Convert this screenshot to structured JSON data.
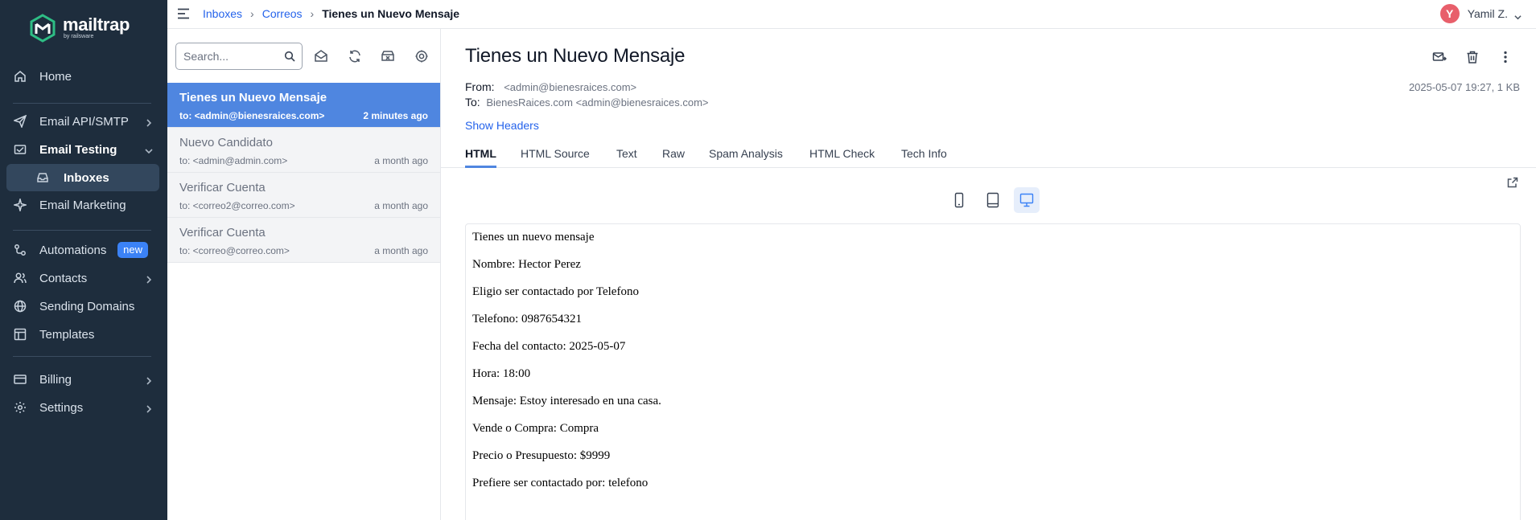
{
  "app": {
    "logo_word": "mailtrap",
    "logo_sub": "by railsware",
    "accent_color": "#4f86e0",
    "sidebar_bg": "#1e2d3d"
  },
  "sidebar": {
    "items": [
      {
        "label": "Home",
        "icon": "home-icon"
      },
      {
        "label": "Email API/SMTP",
        "icon": "send-icon"
      },
      {
        "label": "Email Testing",
        "icon": "testing-icon"
      },
      {
        "label": "Inboxes",
        "icon": "inbox-icon"
      },
      {
        "label": "Email Marketing",
        "icon": "sparkle-icon"
      },
      {
        "label": "Automations",
        "icon": "automation-icon",
        "badge": "new"
      },
      {
        "label": "Contacts",
        "icon": "contacts-icon"
      },
      {
        "label": "Sending Domains",
        "icon": "globe-icon"
      },
      {
        "label": "Templates",
        "icon": "template-icon"
      },
      {
        "label": "Billing",
        "icon": "card-icon"
      },
      {
        "label": "Settings",
        "icon": "gear-icon"
      }
    ]
  },
  "topbar": {
    "breadcrumb": [
      "Inboxes",
      "Correos",
      "Tienes un Nuevo Mensaje"
    ],
    "user_initial": "Y",
    "user_name": "Yamil Z."
  },
  "list": {
    "search_placeholder": "Search...",
    "messages": [
      {
        "subject": "Tienes un Nuevo Mensaje",
        "to": "to: <admin@bienesraices.com>",
        "when": "2 minutes ago",
        "selected": true
      },
      {
        "subject": "Nuevo Candidato",
        "to": "to: <admin@admin.com>",
        "when": "a month ago",
        "selected": false
      },
      {
        "subject": "Verificar Cuenta",
        "to": "to: <correo2@correo.com>",
        "when": "a month ago",
        "selected": false
      },
      {
        "subject": "Verificar Cuenta",
        "to": "to: <correo@correo.com>",
        "when": "a month ago",
        "selected": false
      }
    ]
  },
  "detail": {
    "subject": "Tienes un Nuevo Mensaje",
    "from_label": "From:",
    "from_value": "<admin@bienesraices.com>",
    "to_label": "To:",
    "to_value": "BienesRaices.com <admin@bienesraices.com>",
    "date": "2025-05-07 19:27, 1 KB",
    "show_headers": "Show Headers",
    "tabs": [
      "HTML",
      "HTML Source",
      "Text",
      "Raw",
      "Spam Analysis",
      "HTML Check",
      "Tech Info"
    ],
    "active_tab": "HTML",
    "body_lines": [
      "Tienes un nuevo mensaje",
      "Nombre: Hector Perez",
      "Eligio ser contactado por Telefono",
      "Telefono: 0987654321",
      "Fecha del contacto: 2025-05-07",
      "Hora: 18:00",
      "Mensaje: Estoy interesado en una casa.",
      "Vende o Compra: Compra",
      "Precio o Presupuesto: $9999",
      "Prefiere ser contactado por: telefono"
    ]
  }
}
